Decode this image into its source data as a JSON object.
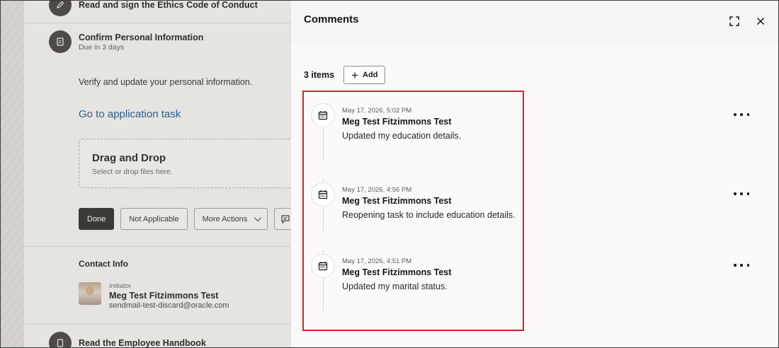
{
  "background": {
    "task_top_title": "Read and sign the Ethics Code of Conduct",
    "task_current": {
      "title": "Confirm Personal Information",
      "due": "Due in 3 days",
      "description": "Verify and update your personal information.",
      "link": "Go to application task"
    },
    "dropzone": {
      "title": "Drag and Drop",
      "subtitle": "Select or drop files here."
    },
    "buttons": {
      "done": "Done",
      "not_applicable": "Not Applicable",
      "more_actions": "More Actions"
    },
    "contact": {
      "heading": "Contact Info",
      "role": "Initiator",
      "name": "Meg Test Fitzimmons Test",
      "email": "sendmail-test-discard@oracle.com"
    },
    "task_bottom_title": "Read the Employee Handbook"
  },
  "drawer": {
    "title": "Comments",
    "count": "3 items",
    "add_label": "Add",
    "comments": [
      {
        "date": "May 17, 2026, 5:02 PM",
        "author": "Meg Test Fitzimmons Test",
        "body": "Updated my education details."
      },
      {
        "date": "May 17, 2026, 4:56 PM",
        "author": "Meg Test Fitzimmons Test",
        "body": "Reopening task to include education details."
      },
      {
        "date": "May 17, 2026, 4:51 PM",
        "author": "Meg Test Fitzimmons Test",
        "body": "Updated my marital status."
      }
    ]
  },
  "icons": {
    "expand": "expand-icon",
    "close": "close-icon",
    "add": "plus-icon",
    "comment": "calendar-icon",
    "more": "more-options-icon",
    "task": "task-icon"
  },
  "colors": {
    "highlight": "#d3232e",
    "link": "#2b5d8a",
    "primary_button": "#3c3a37"
  }
}
